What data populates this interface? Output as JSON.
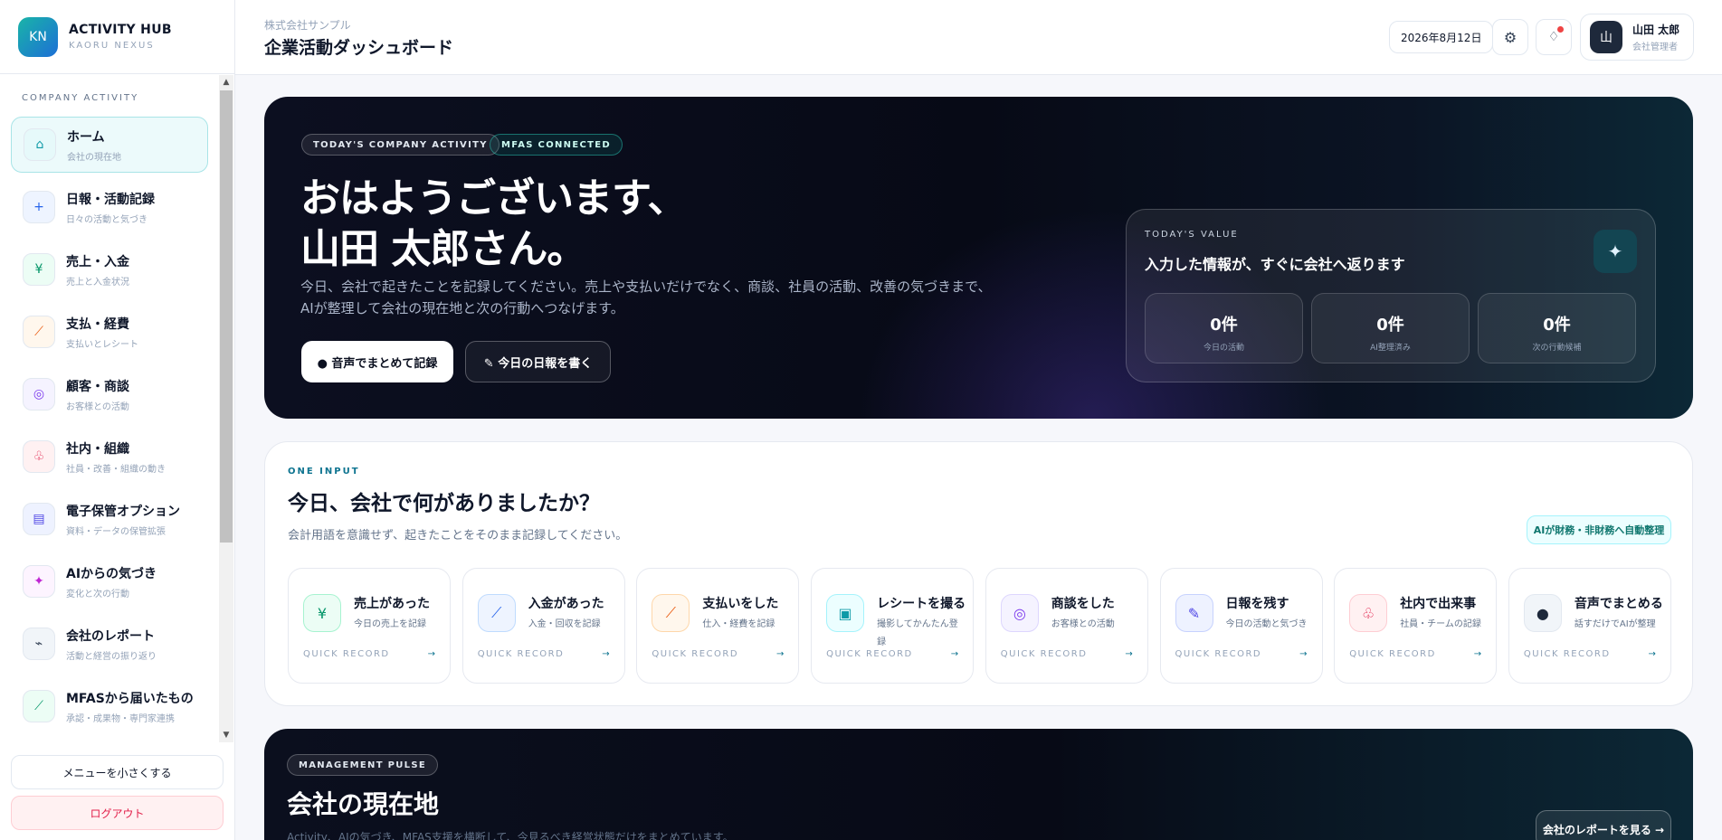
{
  "sidebar": {
    "logo_text": "KN",
    "brand_title": "ACTIVITY HUB",
    "brand_sub": "KAORU NEXUS",
    "section_label": "COMPANY ACTIVITY",
    "items": [
      {
        "label": "ホーム",
        "sub": "会社の現在地",
        "icon": "home-icon",
        "glyph": "⌂",
        "color": "#0e9aa7",
        "bg": "#e6f9fa",
        "active": true
      },
      {
        "label": "日報・活動記録",
        "sub": "日々の活動と気づき",
        "icon": "plus-icon",
        "glyph": "+",
        "color": "#2563eb",
        "bg": "#eef4ff",
        "active": false
      },
      {
        "label": "売上・入金",
        "sub": "売上と入金状況",
        "icon": "yen-icon",
        "glyph": "¥",
        "color": "#059669",
        "bg": "#ecfdf5",
        "active": false
      },
      {
        "label": "支払・経費",
        "sub": "支払いとレシート",
        "icon": "expense-icon",
        "glyph": "⟋",
        "color": "#ea580c",
        "bg": "#fff7ed",
        "active": false
      },
      {
        "label": "顧客・商談",
        "sub": "お客様との活動",
        "icon": "customer-icon",
        "glyph": "◎",
        "color": "#7c3aed",
        "bg": "#f5f3ff",
        "active": false
      },
      {
        "label": "社内・組織",
        "sub": "社員・改善・組織の動き",
        "icon": "organization-icon",
        "glyph": "♧",
        "color": "#e11d48",
        "bg": "#fff1f2",
        "active": false
      },
      {
        "label": "電子保管オプション",
        "sub": "資料・データの保管拡張",
        "icon": "archive-icon",
        "glyph": "▤",
        "color": "#4f46e5",
        "bg": "#eef2ff",
        "active": false
      },
      {
        "label": "AIからの気づき",
        "sub": "変化と次の行動",
        "icon": "sparkle-icon",
        "glyph": "✦",
        "color": "#c026d3",
        "bg": "#fdf4ff",
        "active": false
      },
      {
        "label": "会社のレポート",
        "sub": "活動と経営の振り返り",
        "icon": "report-icon",
        "glyph": "⌁",
        "color": "#334155",
        "bg": "#f1f5f9",
        "active": false
      },
      {
        "label": "MFASから届いたもの",
        "sub": "承認・成果物・専門家連携",
        "icon": "delivery-icon",
        "glyph": "⟋",
        "color": "#059669",
        "bg": "#ecfdf5",
        "active": false
      }
    ],
    "collapse_label": "メニューを小さくする",
    "logout_label": "ログアウト"
  },
  "topbar": {
    "company": "株式会社サンプル",
    "title": "企業活動ダッシュボード",
    "date": "2026年8月12日",
    "user_avatar": "山",
    "user_name": "山田 太郎",
    "user_role": "会社管理者"
  },
  "hero": {
    "pill_activity": "TODAY'S COMPANY ACTIVITY",
    "pill_mfas": "MFAS CONNECTED",
    "greeting_line1": "おはようございます、",
    "greeting_line2": "山田 太郎さん。",
    "description": "今日、会社で起きたことを記録してください。売上や支払いだけでなく、商談、社員の活動、改善の気づきまで、AIが整理して会社の現在地と次の行動へつなげます。",
    "voice_button": "● 音声でまとめて記録",
    "report_button": "✎ 今日の日報を書く",
    "value_card": {
      "tag": "TODAY'S VALUE",
      "title": "入力した情報が、すぐに会社へ返ります",
      "stats": [
        {
          "value": "0件",
          "label": "今日の活動"
        },
        {
          "value": "0件",
          "label": "AI整理済み"
        },
        {
          "value": "0件",
          "label": "次の行動候補"
        }
      ]
    }
  },
  "one_input": {
    "tag": "ONE INPUT",
    "title": "今日、会社で何がありましたか？",
    "subtitle": "会計用語を意識せず、起きたことをそのまま記録してください。",
    "badge": "AIが財務・非財務へ自動整理",
    "quick_tag": "QUICK RECORD",
    "arrow": "→",
    "cards": [
      {
        "title": "売上があった",
        "desc": "今日の売上を記録",
        "icon": "yen-icon",
        "glyph": "¥",
        "color": "#059669",
        "bg": "#ecfdf5",
        "border": "#a7f3d0"
      },
      {
        "title": "入金があった",
        "desc": "入金・回収を記録",
        "icon": "deposit-icon",
        "glyph": "⟋",
        "color": "#2563eb",
        "bg": "#eef4ff",
        "border": "#bfdbfe"
      },
      {
        "title": "支払いをした",
        "desc": "仕入・経費を記録",
        "icon": "payment-icon",
        "glyph": "⟋",
        "color": "#ea580c",
        "bg": "#fff7ed",
        "border": "#fed7aa"
      },
      {
        "title": "レシートを撮る",
        "desc": "撮影してかんたん登録",
        "icon": "camera-icon",
        "glyph": "▣",
        "color": "#0e9aa7",
        "bg": "#ecfeff",
        "border": "#a5f3fc"
      },
      {
        "title": "商談をした",
        "desc": "お客様との活動",
        "icon": "meeting-icon",
        "glyph": "◎",
        "color": "#7c3aed",
        "bg": "#f5f3ff",
        "border": "#ddd6fe"
      },
      {
        "title": "日報を残す",
        "desc": "今日の活動と気づき",
        "icon": "pencil-icon",
        "glyph": "✎",
        "color": "#4f46e5",
        "bg": "#eef2ff",
        "border": "#c7d2fe"
      },
      {
        "title": "社内で出来事",
        "desc": "社員・チームの記録",
        "icon": "team-icon",
        "glyph": "♧",
        "color": "#e11d48",
        "bg": "#fff1f2",
        "border": "#fecdd3"
      },
      {
        "title": "音声でまとめる",
        "desc": "話すだけでAIが整理",
        "icon": "voice-icon",
        "glyph": "●",
        "color": "#1e293b",
        "bg": "#f1f5f9",
        "border": "#e2e8f0"
      }
    ]
  },
  "pulse": {
    "tag": "MANAGEMENT PULSE",
    "title": "会社の現在地",
    "subtitle": "Activity、AIの気づき、MFAS支援を横断して、今見るべき経営状態だけをまとめています。",
    "report_button": "会社のレポートを見る →"
  }
}
